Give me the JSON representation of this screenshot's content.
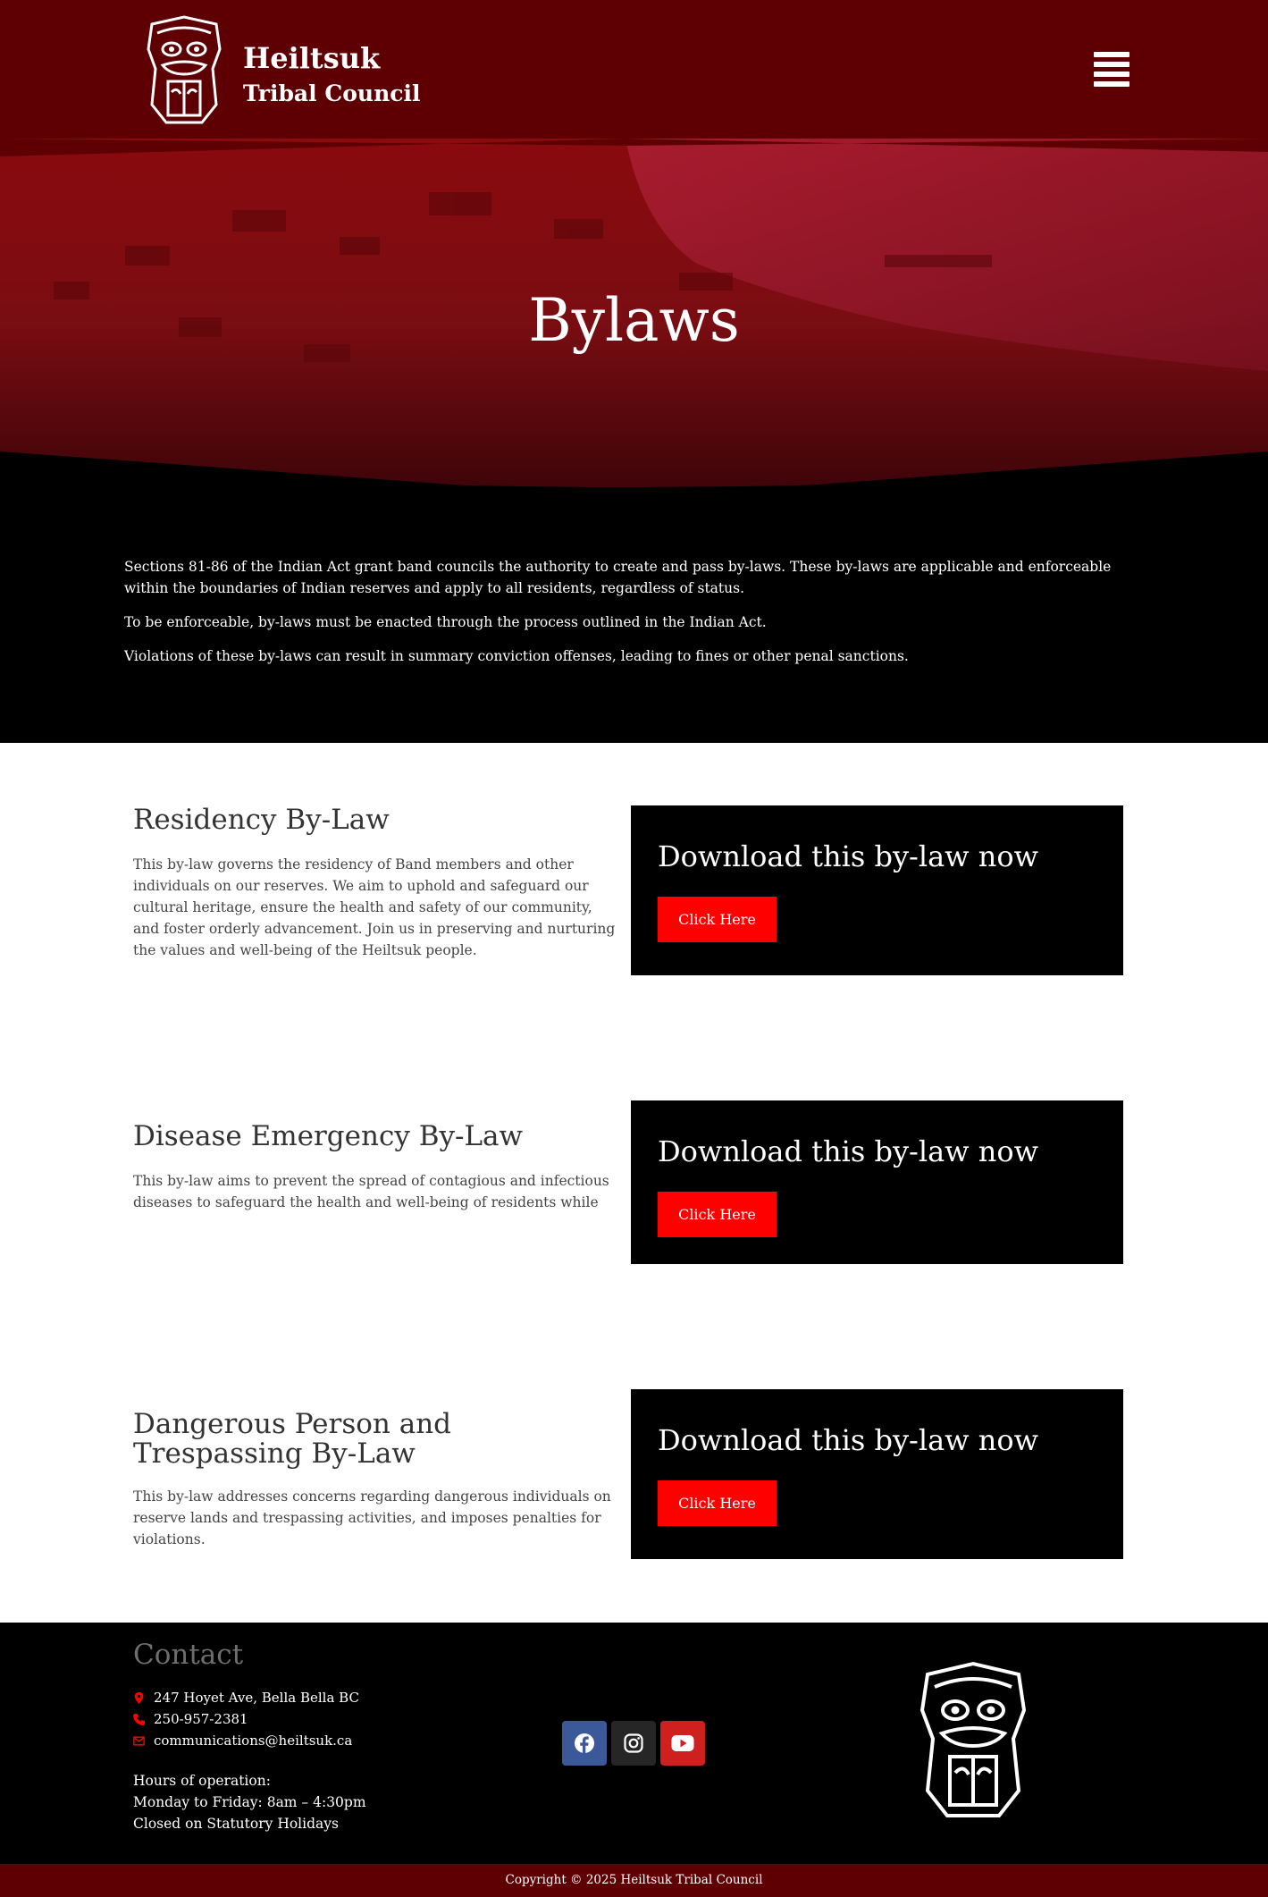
{
  "header": {
    "brand_name": "Heiltsuk",
    "brand_sub": "Tribal Council"
  },
  "hero": {
    "title": "Bylaws"
  },
  "intro": {
    "paragraphs": [
      "Sections 81-86 of the Indian Act grant band councils the authority to create and pass by-laws.  These by-laws are applicable and enforceable within the boundaries of Indian reserves and apply to all residents, regardless of status.",
      "To be enforceable, by-laws must be enacted through the process outlined in the Indian Act.",
      "Violations of these by-laws can result in summary conviction offenses, leading to fines or other penal sanctions."
    ]
  },
  "bylaws": [
    {
      "title": "Residency By-Law",
      "description": "This by-law governs the residency of Band members and other individuals on our reserves.  We aim to uphold and safeguard our cultural heritage, ensure the health and safety of our community, and foster orderly advancement.  Join us in preserving and nurturing the values and well-being of the Heiltsuk people.",
      "download_title": "Download this by-law now",
      "button_label": "Click Here"
    },
    {
      "title": "Disease Emergency By-Law",
      "description": "This by-law aims to prevent the spread of contagious and infectious diseases to safeguard the health and well-being of residents while",
      "download_title": "Download this by-law now",
      "button_label": "Click Here"
    },
    {
      "title": "Dangerous Person and Trespassing By-Law",
      "description": "This by-law addresses concerns regarding dangerous individuals on reserve lands and trespassing activities, and imposes penalties for violations.",
      "download_title": "Download this by-law now",
      "button_label": "Click Here"
    }
  ],
  "footer": {
    "contact_title": "Contact",
    "address": "247 Hoyet Ave, Bella Bella BC",
    "phone": "250-957-2381",
    "email": "communications@heiltsuk.ca",
    "hours_label": "Hours of operation:",
    "hours_weekdays": "Monday to Friday: 8am – 4:30pm",
    "hours_holidays": "Closed on Statutory Holidays",
    "social": [
      {
        "icon": "facebook-icon",
        "color": "#3b5998"
      },
      {
        "icon": "instagram-icon",
        "color": "#262626"
      },
      {
        "icon": "youtube-icon",
        "color": "#cd201f"
      }
    ]
  },
  "copyright": "Copyright © 2025 Heiltsuk Tribal Council",
  "colors": {
    "header_bg": "#5e0003",
    "accent": "#ff0000",
    "dark": "#000000"
  }
}
